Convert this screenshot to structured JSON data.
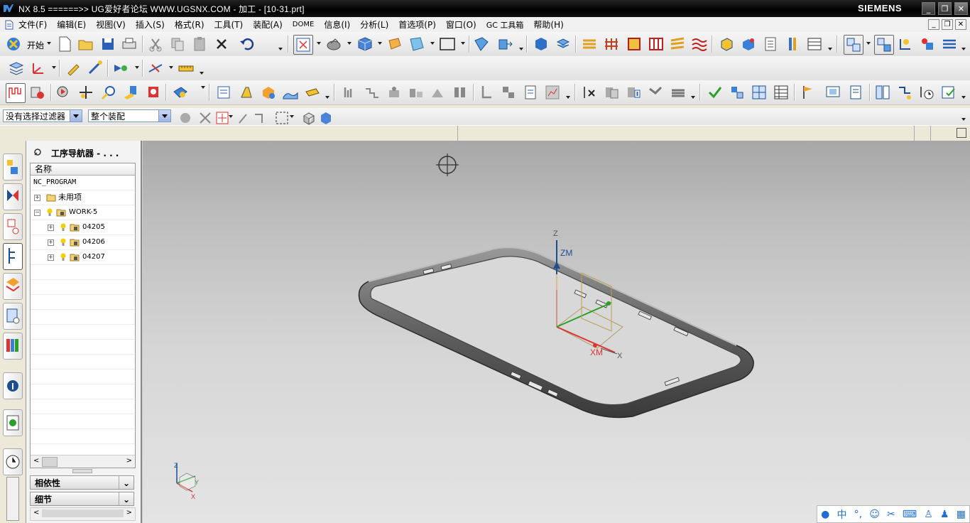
{
  "window": {
    "title": "NX 8.5  ======>>  UG爱好者论坛  WWW.UGSNX.COM - 加工 - [10-31.prt]",
    "brand": "SIEMENS",
    "controls": [
      "_",
      "❐",
      "✕"
    ]
  },
  "menubar": {
    "items": [
      "文件(F)",
      "编辑(E)",
      "视图(V)",
      "插入(S)",
      "格式(R)",
      "工具(T)",
      "装配(A)",
      "DOME",
      "信息(I)",
      "分析(L)",
      "首选项(P)",
      "窗口(O)",
      "GC 工具箱",
      "帮助(H)"
    ]
  },
  "toolbar": {
    "start_label": "开始"
  },
  "selection_bar": {
    "filter_value": "没有选择过滤器",
    "scope_value": "整个装配"
  },
  "navigator": {
    "title": "工序导航器 - . . .",
    "column_header": "名称",
    "tree": [
      {
        "label": "NC_PROGRAM",
        "level": 0
      },
      {
        "label": "未用项",
        "level": 1
      },
      {
        "label": "WORK-5",
        "level": 1
      },
      {
        "label": "04205",
        "level": 2
      },
      {
        "label": "04206",
        "level": 2
      },
      {
        "label": "04207",
        "level": 2
      }
    ],
    "sections": [
      "相依性",
      "细节"
    ]
  },
  "viewport": {
    "axis_labels": {
      "z": "Z",
      "zm": "ZM",
      "xm": "XM",
      "x": "X",
      "y": "Y"
    },
    "triad": {
      "z": "Z",
      "y": "Y",
      "x": "X"
    }
  },
  "ime": {
    "label": "中"
  },
  "colors": {
    "titlebar": "#000000",
    "viewport_top": "#a7a7a7",
    "viewport_bottom": "#e4e4e4",
    "part": "#6f6f6f",
    "accent_blue": "#1f6fd1"
  }
}
